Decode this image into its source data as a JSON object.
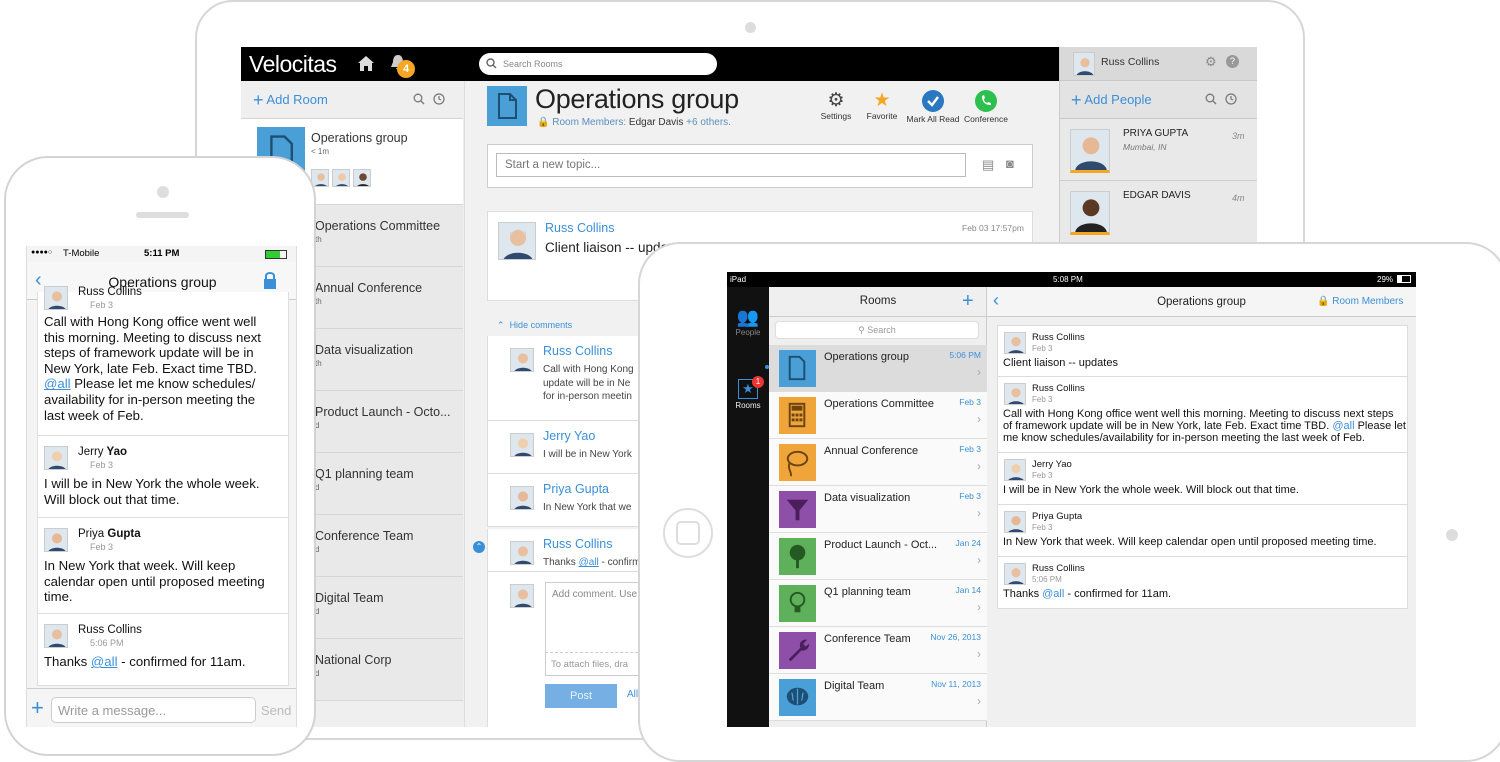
{
  "desktop": {
    "brand": "Velocitas",
    "notif_count": "4",
    "search_placeholder": "Search Rooms",
    "add_room": "Add Room",
    "rooms": [
      {
        "name": "Operations group",
        "sub": "< 1m"
      },
      {
        "name": "Operations Committee",
        "sub": "th"
      },
      {
        "name": "Annual Conference",
        "sub": "th"
      },
      {
        "name": "Data visualization",
        "sub": "th"
      },
      {
        "name": "Product Launch - Octo...",
        "sub": "d"
      },
      {
        "name": "Q1 planning team",
        "sub": "d"
      },
      {
        "name": "Conference Team",
        "sub": "d"
      },
      {
        "name": "Digital Team",
        "sub": "d"
      },
      {
        "name": "National Corp",
        "sub": "d"
      }
    ],
    "room_title": "Operations group",
    "room_members_label": "Room Members:",
    "room_members": "Edgar Davis",
    "room_members_more": "+6 others.",
    "toolbar": {
      "settings": "Settings",
      "favorite": "Favorite",
      "mark_all_read": "Mark All Read",
      "conference": "Conference"
    },
    "topic_placeholder": "Start a new topic...",
    "post": {
      "author": "Russ Collins",
      "title": "Client liaison -- upda",
      "time": "Feb 03 17:57pm"
    },
    "hide_comments": "Hide comments",
    "comments": [
      {
        "author": "Russ Collins",
        "lines": [
          "Call with Hong Kong",
          "update will be in Ne",
          "for in-person meetin"
        ]
      },
      {
        "author": "Jerry Yao",
        "lines": [
          "I will be in New York"
        ]
      },
      {
        "author": "Priya Gupta",
        "lines": [
          "In New York that we"
        ]
      },
      {
        "author": "Russ Collins",
        "pre": "Thanks ",
        "mention": "@all",
        "post": " - confirm"
      }
    ],
    "comment_placeholder": "Add comment. Use",
    "attach_hint": "To attach files, dra",
    "post_button": "Post",
    "all_link": "All",
    "right": {
      "user": "Russ Collins",
      "add_people": "Add People",
      "people": [
        {
          "name": "PRIYA GUPTA",
          "loc": "Mumbai, IN",
          "time": "3m"
        },
        {
          "name": "EDGAR DAVIS",
          "loc": "",
          "time": "4m"
        }
      ]
    }
  },
  "phone": {
    "carrier": "T-Mobile",
    "time": "5:11 PM",
    "title": "Operations group",
    "messages": [
      {
        "author": "Russ Collins",
        "date": "Feb 3",
        "lines": [
          "Call with Hong Kong office went well",
          "this morning. Meeting to discuss next",
          "steps of framework update will be in",
          "New York, late Feb. Exact time TBD."
        ],
        "mention": "@all",
        "after": " Please let me know schedules/",
        "tail": [
          "availability for in-person meeting the",
          "last week of Feb."
        ]
      },
      {
        "author_first": "Jerry",
        "author_last": "Yao",
        "date": "Feb 3",
        "lines": [
          "I will be in New York the whole week.",
          "Will block out that time."
        ]
      },
      {
        "author_first": "Priya",
        "author_last": "Gupta",
        "date": "Feb 3",
        "lines": [
          "In New York that week. Will keep",
          "calendar open until proposed meeting",
          "time."
        ]
      },
      {
        "author": "Russ Collins",
        "date": "5:06 PM",
        "pre": "Thanks ",
        "mention": "@all",
        "post": " - confirmed for 11am."
      }
    ],
    "input_placeholder": "Write a message...",
    "send": "Send"
  },
  "tablet": {
    "device": "iPad",
    "time": "5:08 PM",
    "battery": "29%",
    "side": {
      "people": "People",
      "rooms": "Rooms",
      "rooms_badge": "1"
    },
    "list_title": "Rooms",
    "search_placeholder": "Search",
    "rooms": [
      {
        "name": "Operations group",
        "date": "5:06 PM",
        "color": "#4a9fd6",
        "icon": "document-icon"
      },
      {
        "name": "Operations Committee",
        "date": "Feb 3",
        "color": "#f0a53a",
        "icon": "calculator-icon"
      },
      {
        "name": "Annual Conference",
        "date": "Feb 3",
        "color": "#f0a53a",
        "icon": "lasso-icon"
      },
      {
        "name": "Data visualization",
        "date": "Feb 3",
        "color": "#8e4fa8",
        "icon": "funnel-icon"
      },
      {
        "name": "Product Launch -  Oct...",
        "date": "Jan 24",
        "color": "#5fb05a",
        "icon": "tree-icon"
      },
      {
        "name": "Q1 planning team",
        "date": "Jan 14",
        "color": "#5fb05a",
        "icon": "lightbulb-icon"
      },
      {
        "name": "Conference Team",
        "date": "Nov 26, 2013",
        "color": "#8e4fa8",
        "icon": "wrench-icon"
      },
      {
        "name": "Digital Team",
        "date": "Nov 11, 2013",
        "color": "#4a9fd6",
        "icon": "brain-icon"
      }
    ],
    "chat_title": "Operations group",
    "room_members": "Room Members",
    "messages": [
      {
        "author": "Russ Collins",
        "date": "Feb 3",
        "lines": [
          "Client liaison -- updates"
        ]
      },
      {
        "author": "Russ Collins",
        "date": "Feb 3",
        "lines": [
          "Call with Hong Kong office went well this morning. Meeting to discuss next steps",
          "of framework update will be in New York, late Feb. Exact time TBD."
        ],
        "mention": "@all",
        "after": " Please let",
        "tail": [
          "me know schedules/availability for in-person meeting the last week of Feb."
        ]
      },
      {
        "author": "Jerry Yao",
        "date": "Feb 3",
        "lines": [
          "I will be in New York the whole week. Will block out that time."
        ]
      },
      {
        "author": "Priya Gupta",
        "date": "Feb 3",
        "lines": [
          "In New York that week. Will keep calendar open until proposed meeting time."
        ]
      },
      {
        "author": "Russ Collins",
        "date": "5:06 PM",
        "pre": "Thanks ",
        "mention": "@all",
        "post": " - confirmed for 11am."
      }
    ]
  }
}
